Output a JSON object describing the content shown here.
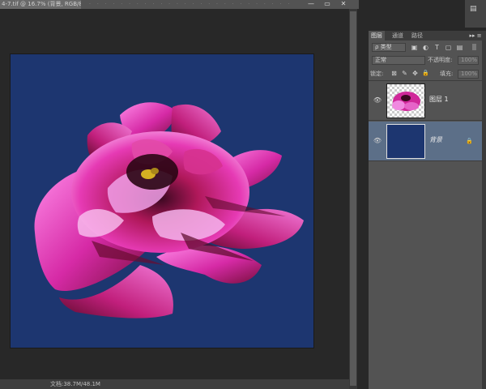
{
  "document": {
    "tab_title": "4-7.tif @ 16.7% (背景, RGB/8)",
    "status_text": "文档:38.7M/48.1M"
  },
  "window_controls": {
    "minimize": "—",
    "restore": "▭",
    "close": "✕"
  },
  "canvas": {
    "background_color": "#1d3670",
    "image_subject": "pink peony flower"
  },
  "layers_panel": {
    "tabs": [
      {
        "label": "图层",
        "active": true
      },
      {
        "label": "通道",
        "active": false
      },
      {
        "label": "路径",
        "active": false
      }
    ],
    "menu_glyph": "▸▸ ≡",
    "filter": {
      "type_label": "ρ 类型",
      "icons": [
        "image-filter-icon",
        "adjustment-filter-icon",
        "type-filter-icon",
        "shape-filter-icon",
        "smart-object-filter-icon"
      ],
      "icon_glyphs": [
        "▣",
        "◐",
        "T",
        "▢",
        "▤"
      ]
    },
    "blend_mode": "正常",
    "opacity_label": "不透明度:",
    "opacity_value": "100%",
    "lock_label": "锁定:",
    "lock_icons": [
      "lock-transparency-icon",
      "lock-pixels-icon",
      "lock-position-icon",
      "lock-all-icon"
    ],
    "lock_glyphs": [
      "⊠",
      "✎",
      "✥",
      "🔒"
    ],
    "fill_label": "填充:",
    "fill_value": "100%",
    "layers": [
      {
        "name": "图层 1",
        "visible": true,
        "selected": false,
        "locked": false
      },
      {
        "name": "背景",
        "visible": true,
        "selected": true,
        "locked": true
      }
    ]
  }
}
